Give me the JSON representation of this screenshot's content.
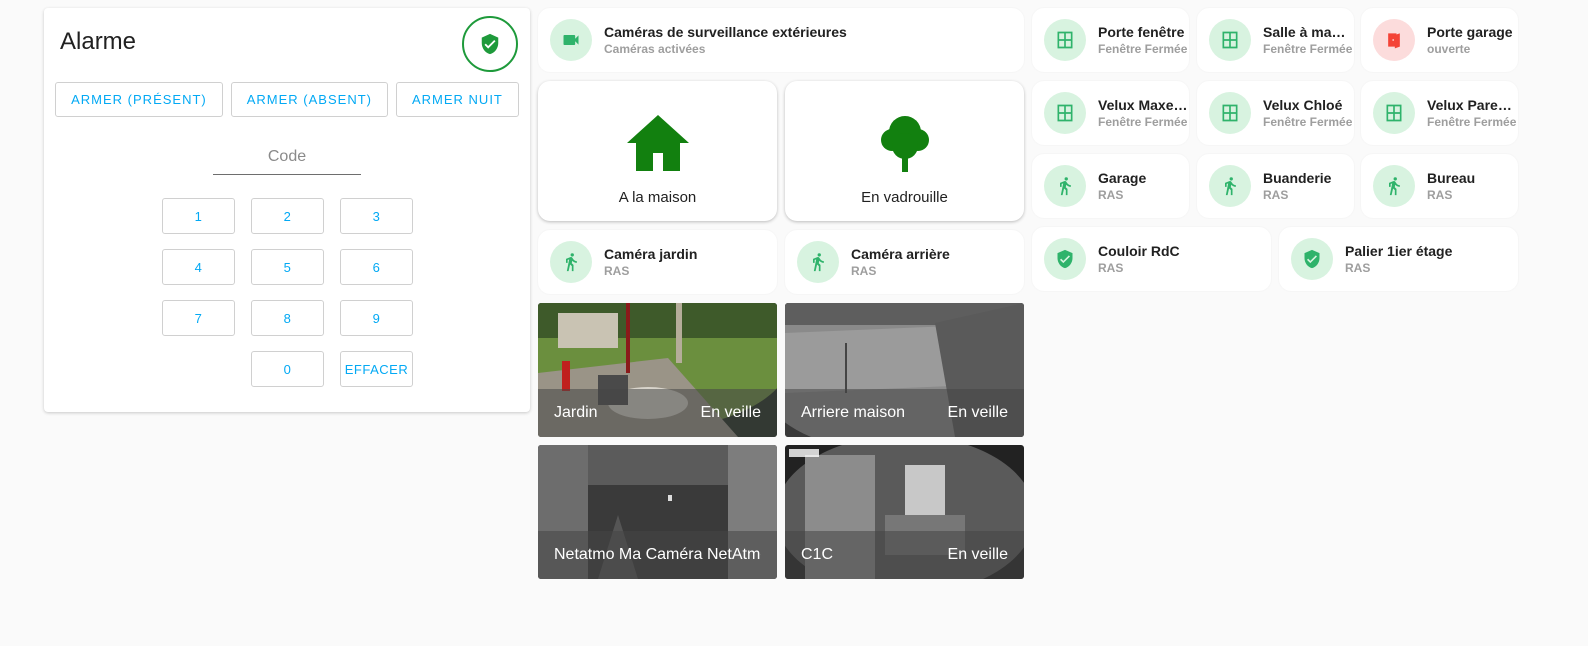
{
  "alarm": {
    "title": "Alarme",
    "arm_buttons": [
      "ARMER (PRÉSENT)",
      "ARMER (ABSENT)",
      "ARMER NUIT"
    ],
    "code_placeholder": "Code",
    "keys": [
      "1",
      "2",
      "3",
      "4",
      "5",
      "6",
      "7",
      "8",
      "9",
      "",
      "0",
      "EFFACER"
    ],
    "icon": "shield-check-icon"
  },
  "cameras_tile": {
    "name": "Caméras de surveillance extérieures",
    "state": "Caméras activées",
    "icon": "video-camera-icon"
  },
  "presence": [
    {
      "label": "A la maison",
      "icon": "house-icon"
    },
    {
      "label": "En vadrouille",
      "icon": "tree-icon"
    }
  ],
  "motion_tiles": [
    {
      "name": "Caméra jardin",
      "state": "RAS",
      "icon": "walking-person-icon"
    },
    {
      "name": "Caméra arrière",
      "state": "RAS",
      "icon": "walking-person-icon"
    }
  ],
  "right_tiles": {
    "row1": [
      {
        "name": "Porte fenêtre",
        "state": "Fenêtre Fermée",
        "icon": "window-icon"
      },
      {
        "name": "Salle à manger",
        "state": "Fenêtre Fermée",
        "icon": "window-icon"
      },
      {
        "name": "Porte garage",
        "state": "ouverte",
        "icon": "door-open-icon"
      }
    ],
    "row2": [
      {
        "name": "Velux Maxence",
        "state": "Fenêtre Fermée",
        "icon": "window-icon"
      },
      {
        "name": "Velux Chloé",
        "state": "Fenêtre Fermée",
        "icon": "window-icon"
      },
      {
        "name": "Velux Parents",
        "state": "Fenêtre Fermée",
        "icon": "window-icon"
      }
    ],
    "row3": [
      {
        "name": "Garage",
        "state": "RAS",
        "icon": "walking-person-icon"
      },
      {
        "name": "Buanderie",
        "state": "RAS",
        "icon": "walking-person-icon"
      },
      {
        "name": "Bureau",
        "state": "RAS",
        "icon": "walking-person-icon"
      }
    ],
    "row4": [
      {
        "name": "Couloir RdC",
        "state": "RAS",
        "icon": "shield-check-icon"
      },
      {
        "name": "Palier 1ier étage",
        "state": "RAS",
        "icon": "shield-check-icon"
      }
    ]
  },
  "camera_feeds": [
    {
      "name": "Jardin",
      "state": "En veille"
    },
    {
      "name": "Arriere maison",
      "state": "En veille"
    },
    {
      "name": "Netatmo Ma Caméra NetAtmo S",
      "state": ""
    },
    {
      "name": "C1C",
      "state": "En veille"
    }
  ],
  "colors": {
    "accent": "#03a9f4",
    "green": "#1e9a3b",
    "house_green": "#12800f",
    "icon_bg": "#d8f3e0",
    "red": "#f44336"
  }
}
